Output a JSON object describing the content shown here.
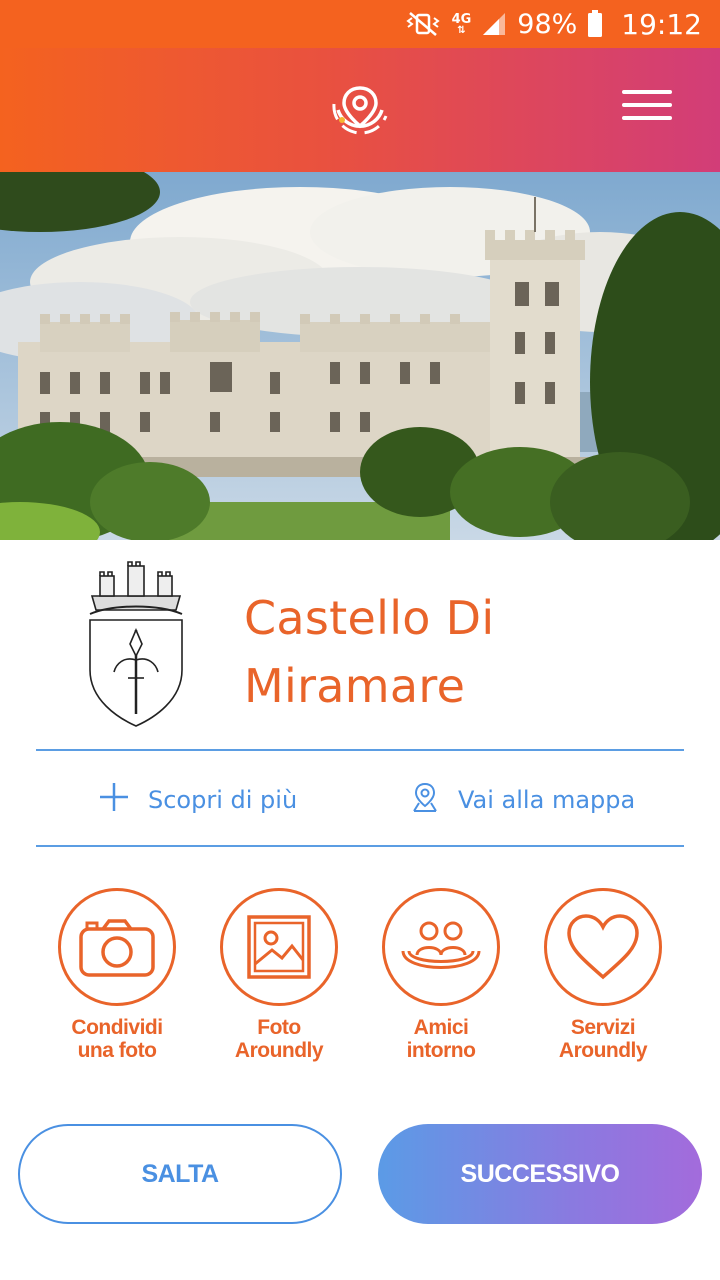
{
  "status_bar": {
    "network": "4G",
    "battery": "98%",
    "time": "19:12"
  },
  "header": {
    "logo_icon": "location-pin-logo-icon",
    "menu_icon": "hamburger-menu-icon"
  },
  "poi": {
    "title": "Castello Di Miramare"
  },
  "actions": {
    "discover_label": "Scopri di più",
    "map_label": "Vai alla mappa"
  },
  "features": [
    {
      "label": "Condividi\nuna foto",
      "icon": "camera-icon"
    },
    {
      "label": "Foto\nAroundly",
      "icon": "picture-icon"
    },
    {
      "label": "Amici\nintorno",
      "icon": "friends-icon"
    },
    {
      "label": "Servizi\nAroundly",
      "icon": "heart-icon"
    }
  ],
  "buttons": {
    "skip_label": "SALTA",
    "next_label": "SUCCESSIVO"
  },
  "colors": {
    "status_bar": "#f4621f",
    "header_start": "#f4621f",
    "header_end": "#d23d78",
    "accent_orange": "#e9642a",
    "accent_blue": "#4a90e2",
    "next_button_end": "#a36bdc"
  }
}
